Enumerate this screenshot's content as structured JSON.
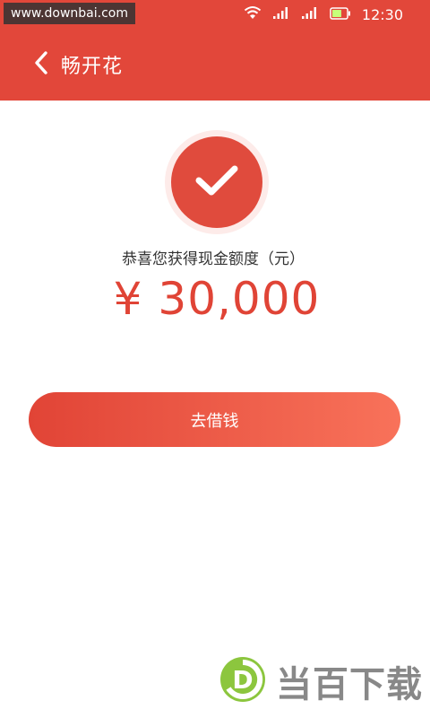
{
  "statusbar": {
    "watermark": "www.downbai.com",
    "time": "12:30",
    "icons": [
      "wifi-icon",
      "signal-icon",
      "signal-icon",
      "battery-icon"
    ]
  },
  "header": {
    "title": "畅开花",
    "back_icon": "chevron-left-icon"
  },
  "result": {
    "icon": "checkmark-icon",
    "message": "恭喜您获得现金额度（元）",
    "amount": "¥ 30,000"
  },
  "actions": {
    "borrow_label": "去借钱"
  },
  "watermark_brand": {
    "text": "当百下载",
    "logo": "D"
  },
  "colors": {
    "brand_red": "#e2473a",
    "amount_red": "#e04436",
    "button_start": "#e14436",
    "button_end": "#f8725a"
  }
}
